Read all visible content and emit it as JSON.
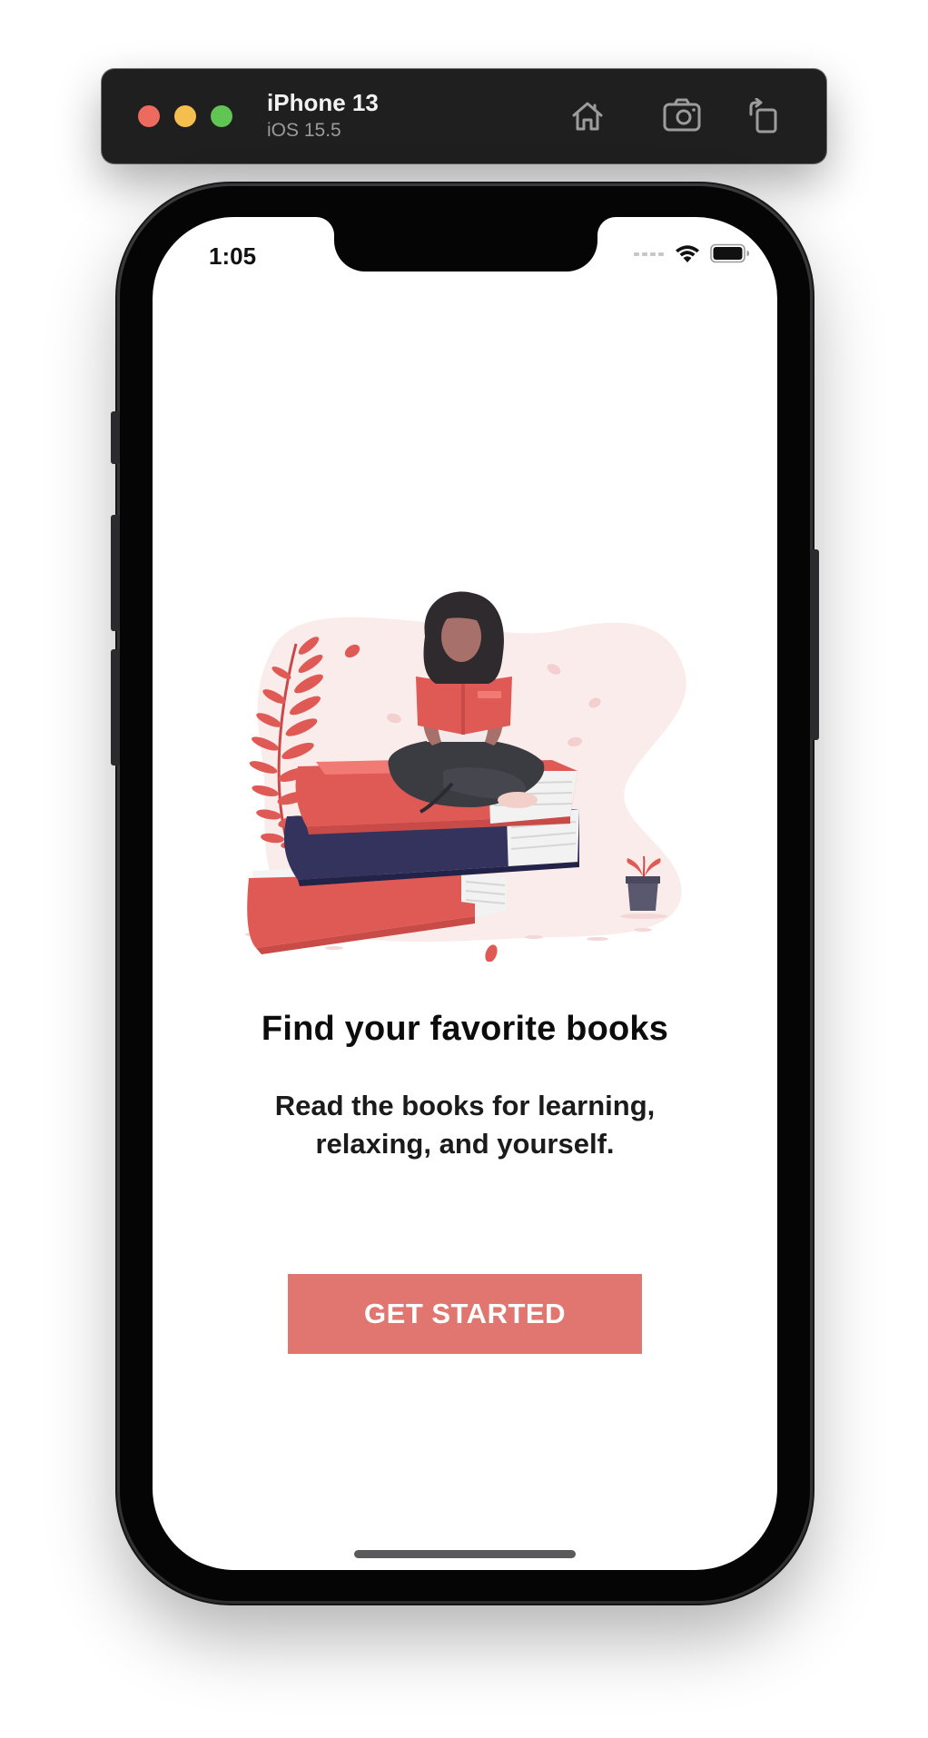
{
  "simulator": {
    "device_name": "iPhone 13",
    "os_version": "iOS 15.5",
    "tools": [
      {
        "icon": "home-icon"
      },
      {
        "icon": "screenshot-icon"
      },
      {
        "icon": "rotate-icon"
      }
    ]
  },
  "status_bar": {
    "time": "1:05",
    "icons": [
      "signal-icon",
      "wifi-icon",
      "battery-icon"
    ]
  },
  "onboarding": {
    "illustration": "reading-woman-on-books-illustration",
    "title": "Find your favorite books",
    "subtitle": "Read the books for learning, relaxing, and yourself.",
    "cta_label": "GET STARTED"
  },
  "colors": {
    "accent": "#e0766f",
    "book_red": "#e05a55",
    "book_navy": "#33335e",
    "skin": "#a8706a",
    "hair": "#2f2a2e",
    "pants": "#3b3b42",
    "blob": "#fbecec",
    "toolbar_bg": "#1f1f1f"
  }
}
